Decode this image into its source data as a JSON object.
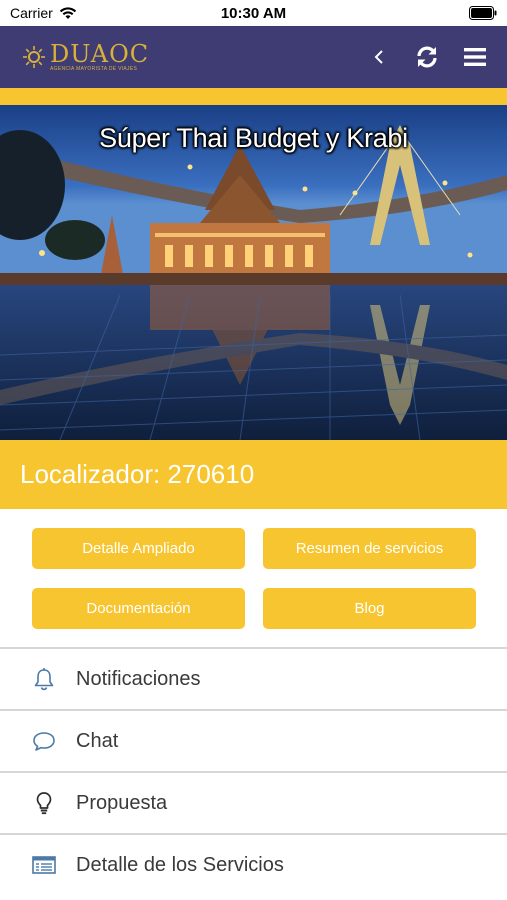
{
  "status_bar": {
    "carrier": "Carrier",
    "time": "10:30 AM"
  },
  "header": {
    "logo_name": "DUAOC",
    "logo_subtitle": "AGENCIA MAYORISTA DE VIAJES",
    "back_icon": "chevron-left-icon",
    "refresh_icon": "refresh-icon",
    "menu_icon": "hamburger-icon"
  },
  "hero": {
    "title": "Súper Thai Budget y Krabi"
  },
  "locator": {
    "text": "Localizador: 270610"
  },
  "actions": [
    {
      "label": "Detalle Ampliado"
    },
    {
      "label": "Resumen de servicios"
    },
    {
      "label": "Documentación"
    },
    {
      "label": "Blog"
    }
  ],
  "menu": [
    {
      "label": "Notificaciones",
      "icon": "bell-icon"
    },
    {
      "label": "Chat",
      "icon": "chat-bubble-icon"
    },
    {
      "label": "Propuesta",
      "icon": "lightbulb-icon"
    },
    {
      "label": "Detalle de los Servicios",
      "icon": "document-list-icon"
    }
  ],
  "colors": {
    "header_bg": "#3f3c73",
    "accent_yellow": "#f7c52f",
    "logo_gold": "#d9b13a",
    "icon_blue": "#4b79a8",
    "divider": "#d6d6d6"
  }
}
